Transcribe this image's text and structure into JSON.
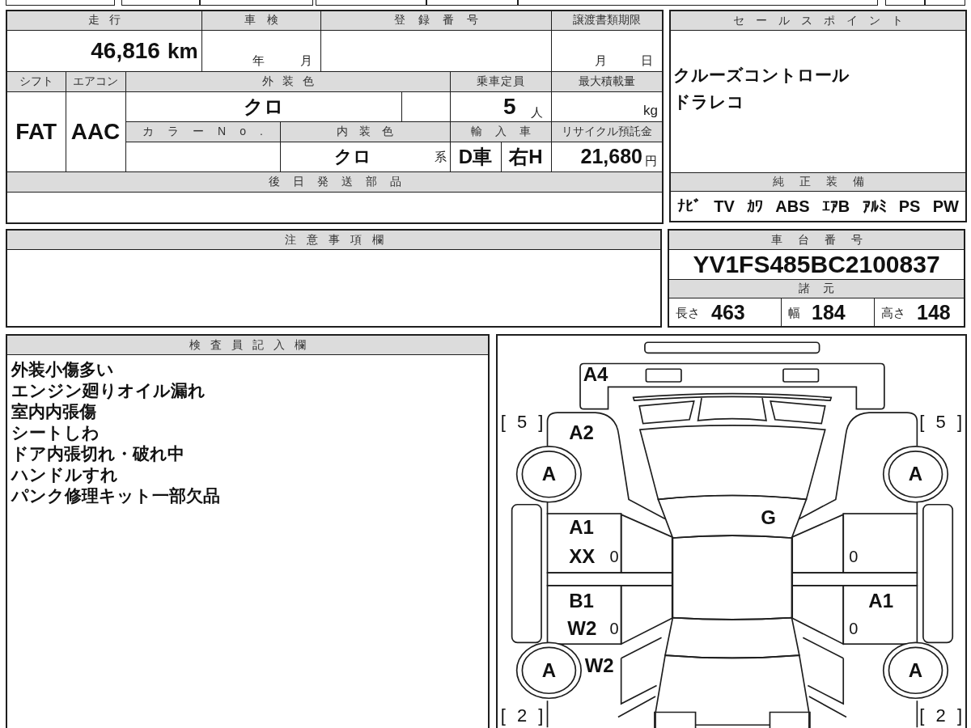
{
  "inspection_table": {
    "mileage": {
      "label": "走行",
      "value": "46,816",
      "unit": "km"
    },
    "shaken": {
      "label": "車検",
      "year_unit": "年",
      "month_unit": "月"
    },
    "registration_number": {
      "label": "登録番号"
    },
    "transfer_deadline": {
      "label": "譲渡書類期限",
      "month_unit": "月",
      "day_unit": "日"
    },
    "shift": {
      "label": "シフト",
      "value": "FAT"
    },
    "air_conditioner": {
      "label": "エアコン",
      "value": "AAC"
    },
    "exterior_color": {
      "label": "外装色",
      "value": "クロ"
    },
    "capacity": {
      "label": "乗車定員",
      "value": "5",
      "unit": "人"
    },
    "max_load": {
      "label": "最大積載量",
      "unit": "kg"
    },
    "color_number": {
      "label": "カラーNo."
    },
    "interior_color": {
      "label": "内装色",
      "value": "クロ",
      "suffix": "系"
    },
    "import": {
      "label": "輸入車",
      "dealer": "D車",
      "steering": "右H"
    },
    "recycle_deposit": {
      "label": "リサイクル預託金",
      "value": "21,680",
      "unit": "円"
    },
    "later_shipping_parts": {
      "label": "後日発送部品"
    }
  },
  "sale_points": {
    "label": "セールスポイント",
    "items": [
      "クルーズコントロール",
      "ドラレコ"
    ]
  },
  "standard_equipment": {
    "label": "純正装備",
    "items": [
      "ﾅﾋﾞ",
      "TV",
      "ｶﾜ",
      "ABS",
      "ｴｱB",
      "ｱﾙﾐ",
      "PS",
      "PW"
    ]
  },
  "notes": {
    "label": "注意事項欄"
  },
  "chassis": {
    "label": "車台番号",
    "number": "YV1FS485BC2100837"
  },
  "dimensions": {
    "label": "諸元",
    "items": [
      {
        "label": "長さ",
        "value": "463"
      },
      {
        "label": "幅",
        "value": "184"
      },
      {
        "label": "高さ",
        "value": "148"
      }
    ]
  },
  "inspector_comments": {
    "label": "検査員記入欄",
    "lines": [
      "外装小傷多い",
      "エンジン廻りオイル漏れ",
      "室内内張傷",
      "シートしわ",
      "ドア内張切れ・破れ中",
      "ハンドルすれ",
      "パンク修理キット一部欠品"
    ]
  },
  "damage_diagram": {
    "panels": {
      "front_bumper": {
        "marks": [
          "A4"
        ]
      },
      "left_front_fender": {
        "marks": [
          "A2"
        ]
      },
      "windshield": {
        "marks": [
          "G"
        ]
      },
      "left_front_door": {
        "marks": [
          "A1",
          "XX"
        ],
        "note": "0"
      },
      "right_front_door": {
        "note": "0"
      },
      "left_rear_door": {
        "marks": [
          "B1",
          "W2"
        ],
        "note": "0"
      },
      "right_rear_door": {
        "marks": [
          "A1"
        ],
        "note": "0"
      },
      "left_rear_quarter": {
        "marks": [
          "W2"
        ]
      }
    },
    "tires": {
      "front_left": {
        "grade": "A",
        "tread": "[ 5 ]"
      },
      "front_right": {
        "grade": "A",
        "tread": "[ 5 ]"
      },
      "rear_left": {
        "grade": "A",
        "tread": "[ 2 ]"
      },
      "rear_right": {
        "grade": "A",
        "tread": "[ 2 ]"
      }
    }
  }
}
